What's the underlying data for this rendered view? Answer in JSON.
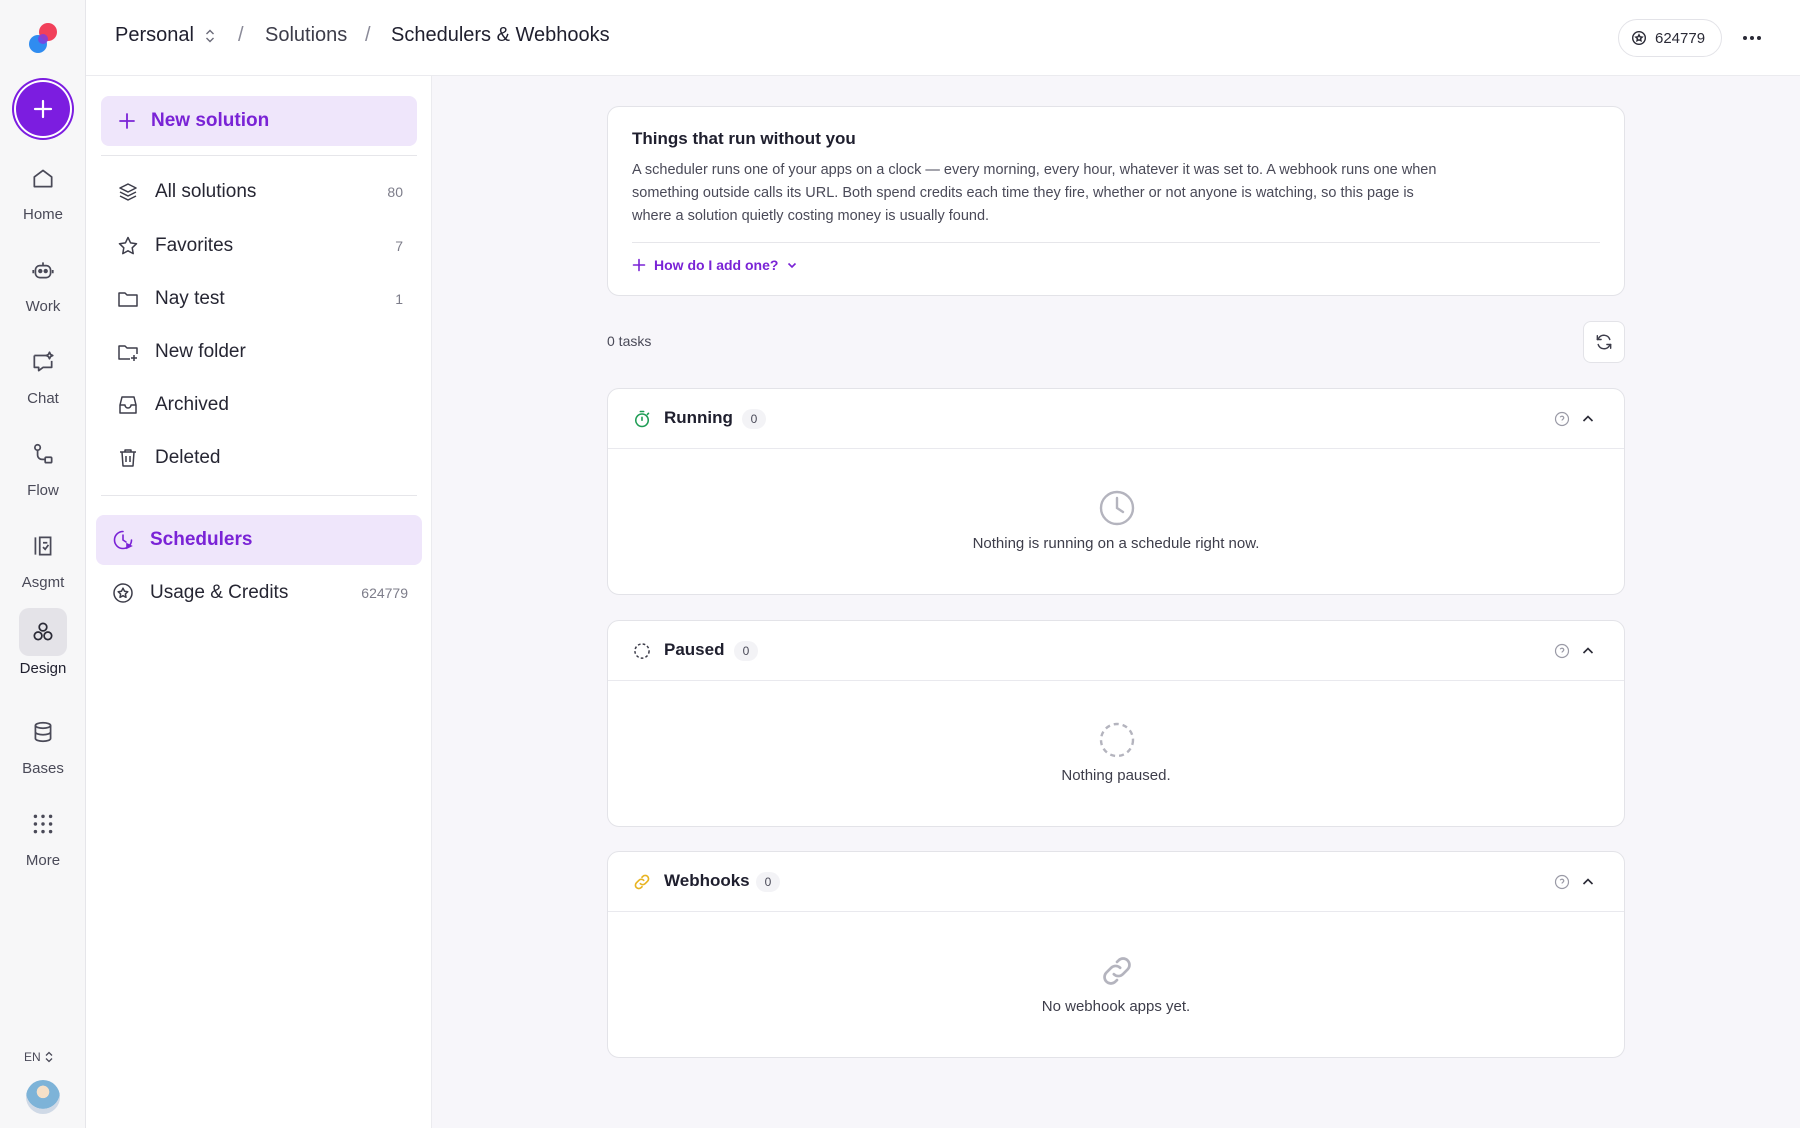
{
  "rail": {
    "items": [
      {
        "label": "Home",
        "icon": "home-icon"
      },
      {
        "label": "Work",
        "icon": "robot-icon"
      },
      {
        "label": "Chat",
        "icon": "chat-sparkle-icon"
      },
      {
        "label": "Flow",
        "icon": "flow-icon"
      },
      {
        "label": "Asgmt",
        "icon": "assignment-icon"
      },
      {
        "label": "Design",
        "icon": "design-icon",
        "active": true
      },
      {
        "label": "Bases",
        "icon": "database-icon"
      },
      {
        "label": "More",
        "icon": "grid-dots-icon"
      }
    ],
    "language": "EN"
  },
  "topbar": {
    "workspace": "Personal",
    "breadcrumb_solutions": "Solutions",
    "breadcrumb_current": "Schedulers & Webhooks",
    "credits": "624779"
  },
  "sidebar": {
    "new_solution": "New solution",
    "items": [
      {
        "label": "All solutions",
        "count": "80",
        "icon": "layers-icon"
      },
      {
        "label": "Favorites",
        "count": "7",
        "icon": "star-icon"
      },
      {
        "label": "Nay test",
        "count": "1",
        "icon": "folder-icon"
      },
      {
        "label": "New folder",
        "count": "",
        "icon": "folder-plus-icon"
      },
      {
        "label": "Archived",
        "count": "",
        "icon": "archive-icon"
      },
      {
        "label": "Deleted",
        "count": "",
        "icon": "trash-icon"
      }
    ],
    "schedulers": "Schedulers",
    "usage": {
      "label": "Usage & Credits",
      "count": "624779"
    }
  },
  "intro": {
    "title": "Things that run without you",
    "body": "A scheduler runs one of your apps on a clock — every morning, every hour, whatever it was set to. A webhook runs one when something outside calls its URL. Both spend credits each time they fire, whether or not anyone is watching, so this page is where a solution quietly costing money is usually found.",
    "link": "How do I add one?"
  },
  "tasks_count": "0 tasks",
  "sections": {
    "running": {
      "title": "Running",
      "count": "0",
      "empty": "Nothing is running on a schedule right now."
    },
    "paused": {
      "title": "Paused",
      "count": "0",
      "empty": "Nothing paused."
    },
    "webhooks": {
      "title": "Webhooks",
      "count": "0",
      "empty": "No webhook apps yet."
    }
  },
  "colors": {
    "accent": "#7a23d6",
    "accent_bg": "#efe6fb",
    "running_green": "#1f9d55",
    "webhook_yellow": "#e8b422"
  }
}
